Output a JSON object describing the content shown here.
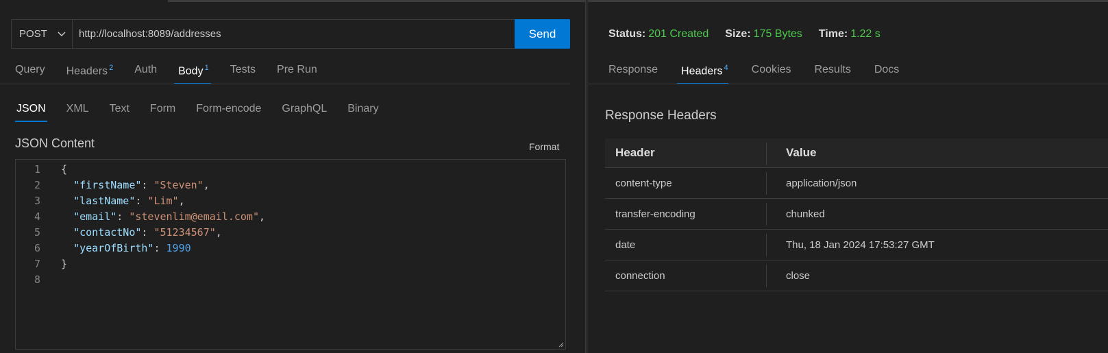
{
  "request": {
    "method": "POST",
    "url": "http://localhost:8089/addresses",
    "send_label": "Send"
  },
  "request_tabs": [
    {
      "label": "Query",
      "badge": ""
    },
    {
      "label": "Headers",
      "badge": "2"
    },
    {
      "label": "Auth",
      "badge": ""
    },
    {
      "label": "Body",
      "badge": "1"
    },
    {
      "label": "Tests",
      "badge": ""
    },
    {
      "label": "Pre Run",
      "badge": ""
    }
  ],
  "body_tabs": [
    "JSON",
    "XML",
    "Text",
    "Form",
    "Form-encode",
    "GraphQL",
    "Binary"
  ],
  "editor": {
    "label": "JSON Content",
    "format_label": "Format",
    "line_numbers": [
      "1",
      "2",
      "3",
      "4",
      "5",
      "6",
      "7",
      "8"
    ],
    "tokens": {
      "open": "{",
      "k1": "\"firstName\"",
      "v1": "\"Steven\"",
      "k2": "\"lastName\"",
      "v2": "\"Lim\"",
      "k3": "\"email\"",
      "v3": "\"stevenlim@email.com\"",
      "k4": "\"contactNo\"",
      "v4": "\"51234567\"",
      "k5": "\"yearOfBirth\"",
      "v5": "1990",
      "close": "}"
    }
  },
  "response": {
    "status_label": "Status:",
    "status_value": "201 Created",
    "size_label": "Size:",
    "size_value": "175 Bytes",
    "time_label": "Time:",
    "time_value": "1.22 s",
    "tabs": [
      {
        "label": "Response",
        "badge": ""
      },
      {
        "label": "Headers",
        "badge": "4"
      },
      {
        "label": "Cookies",
        "badge": ""
      },
      {
        "label": "Results",
        "badge": ""
      },
      {
        "label": "Docs",
        "badge": ""
      }
    ],
    "section_title": "Response Headers",
    "table": {
      "col_header": "Header",
      "col_value": "Value",
      "rows": [
        {
          "header": "content-type",
          "value": "application/json"
        },
        {
          "header": "transfer-encoding",
          "value": "chunked"
        },
        {
          "header": "date",
          "value": "Thu, 18 Jan 2024 17:53:27 GMT"
        },
        {
          "header": "connection",
          "value": "close"
        }
      ]
    }
  },
  "colors": {
    "accent": "#0078d4",
    "success": "#4ec94e",
    "background": "#1f1f1f"
  }
}
